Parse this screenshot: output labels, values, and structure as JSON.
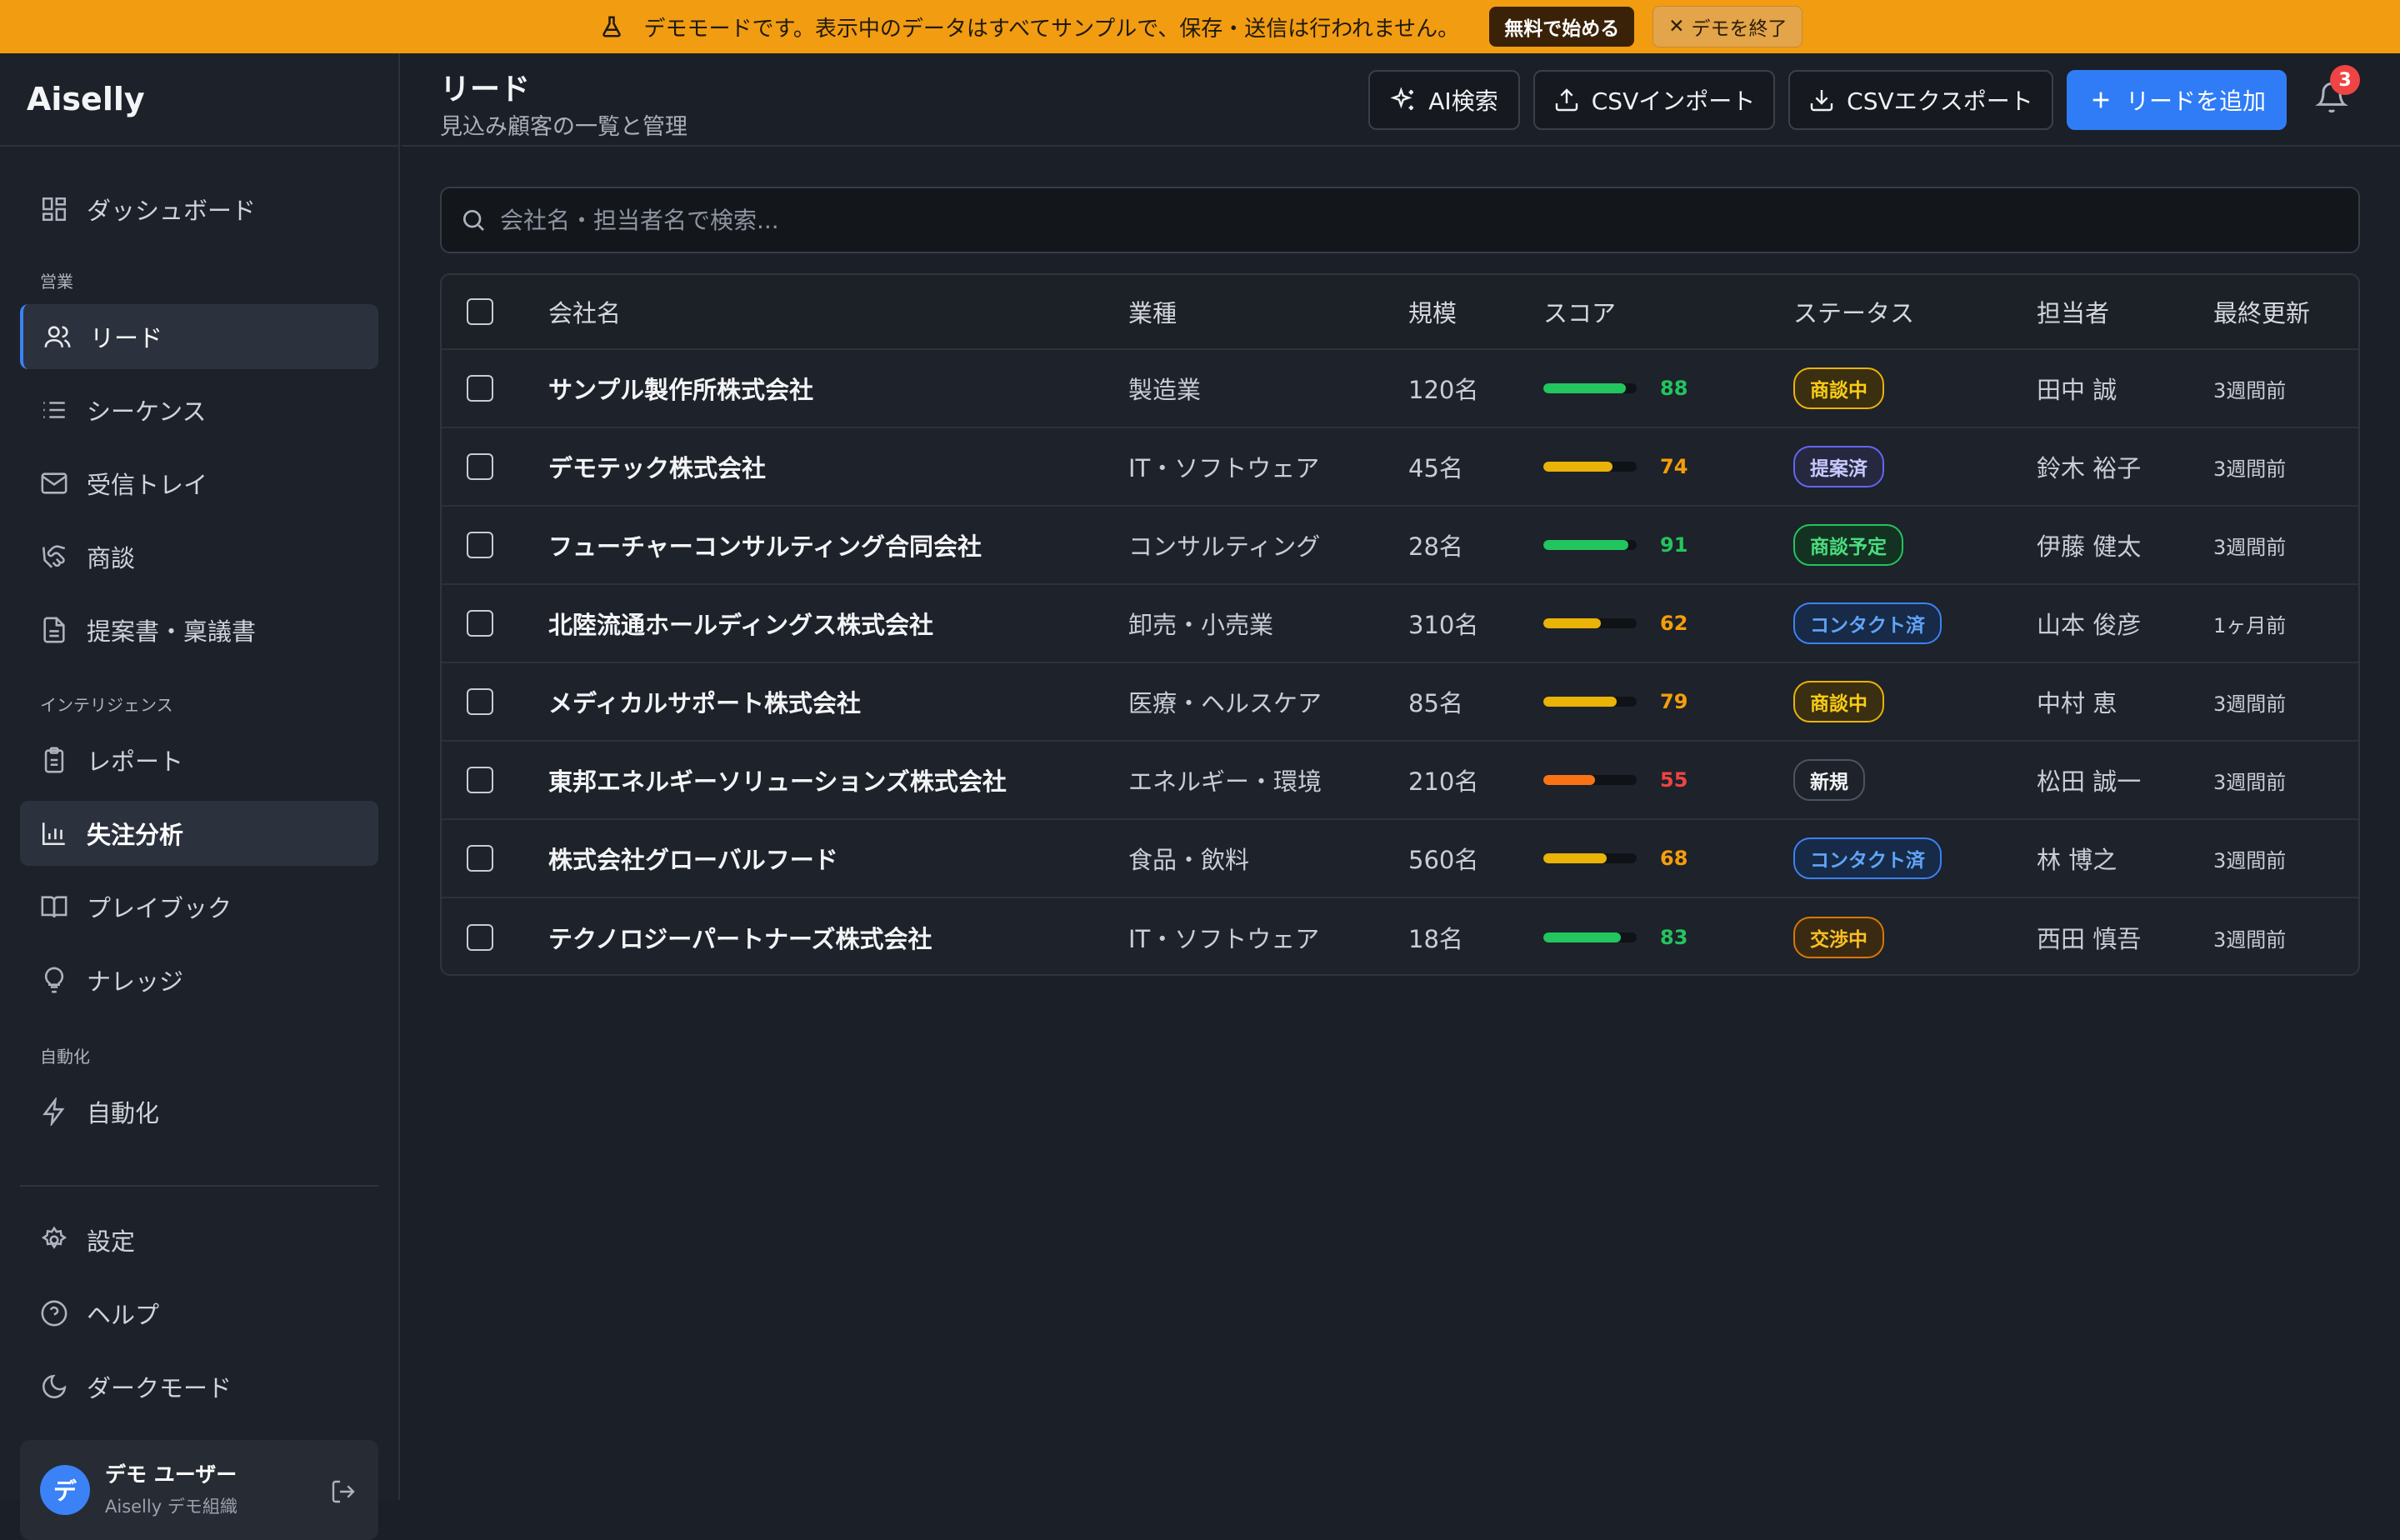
{
  "banner": {
    "message": "デモモードです。表示中のデータはすべてサンプルで、保存・送信は行われません。",
    "start_label": "無料で始める",
    "end_label": "デモを終了"
  },
  "sidebar": {
    "brand": "Aiselly",
    "dashboard": "ダッシュボード",
    "section_sales": "営業",
    "leads": "リード",
    "sequences": "シーケンス",
    "inbox": "受信トレイ",
    "deals": "商談",
    "proposals": "提案書・稟議書",
    "section_intel": "インテリジェンス",
    "reports": "レポート",
    "loss_analysis": "失注分析",
    "playbook": "プレイブック",
    "knowledge": "ナレッジ",
    "section_auto": "自動化",
    "automation": "自動化",
    "settings": "設定",
    "help": "ヘルプ",
    "dark_mode": "ダークモード",
    "user_name": "デモ ユーザー",
    "user_org": "Aiselly デモ組織",
    "avatar_initial": "デ"
  },
  "header": {
    "title": "リード",
    "subtitle": "見込み顧客の一覧と管理",
    "ai_search": "AI検索",
    "csv_import": "CSVインポート",
    "csv_export": "CSVエクスポート",
    "add_lead": "リードを追加",
    "notification_count": "3"
  },
  "search": {
    "placeholder": "会社名・担当者名で検索..."
  },
  "table": {
    "columns": [
      "会社名",
      "業種",
      "規模",
      "スコア",
      "ステータス",
      "担当者",
      "最終更新"
    ],
    "rows": [
      {
        "company": "サンプル製作所株式会社",
        "industry": "製造業",
        "size": "120名",
        "score": "88",
        "status": "商談中",
        "owner": "田中 誠",
        "updated": "3週間前"
      },
      {
        "company": "デモテック株式会社",
        "industry": "IT・ソフトウェア",
        "size": "45名",
        "score": "74",
        "status": "提案済",
        "owner": "鈴木 裕子",
        "updated": "3週間前"
      },
      {
        "company": "フューチャーコンサルティング合同会社",
        "industry": "コンサルティング",
        "size": "28名",
        "score": "91",
        "status": "商談予定",
        "owner": "伊藤 健太",
        "updated": "3週間前"
      },
      {
        "company": "北陸流通ホールディングス株式会社",
        "industry": "卸売・小売業",
        "size": "310名",
        "score": "62",
        "status": "コンタクト済",
        "owner": "山本 俊彦",
        "updated": "1ヶ月前"
      },
      {
        "company": "メディカルサポート株式会社",
        "industry": "医療・ヘルスケア",
        "size": "85名",
        "score": "79",
        "status": "商談中",
        "owner": "中村 恵",
        "updated": "3週間前"
      },
      {
        "company": "東邦エネルギーソリューションズ株式会社",
        "industry": "エネルギー・環境",
        "size": "210名",
        "score": "55",
        "status": "新規",
        "owner": "松田 誠一",
        "updated": "3週間前"
      },
      {
        "company": "株式会社グローバルフード",
        "industry": "食品・飲料",
        "size": "560名",
        "score": "68",
        "status": "コンタクト済",
        "owner": "林 博之",
        "updated": "3週間前"
      },
      {
        "company": "テクノロジーパートナーズ株式会社",
        "industry": "IT・ソフトウェア",
        "size": "18名",
        "score": "83",
        "status": "交渉中",
        "owner": "西田 慎吾",
        "updated": "3週間前"
      }
    ]
  },
  "colors": {
    "accent": "#2f7cf6",
    "banner": "#f29c12",
    "score_high": "#22c55e",
    "score_mid": "#eab308",
    "score_low": "#f97316"
  }
}
